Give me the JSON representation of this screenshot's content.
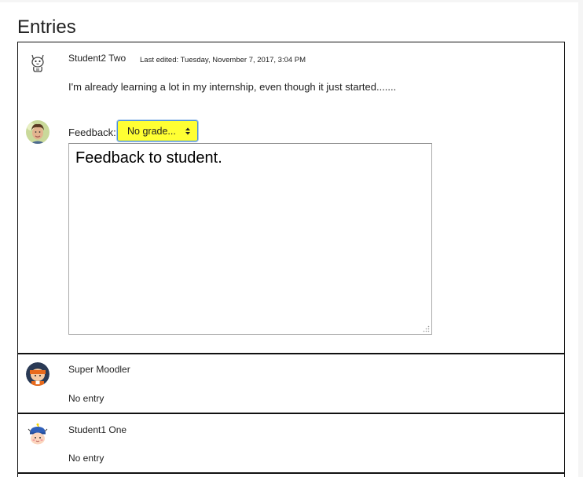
{
  "heading": "Entries",
  "entries": [
    {
      "author": "Student2 Two",
      "last_edited": "Last edited: Tuesday, November 7, 2017, 3:04 PM",
      "text": "I'm already learning a lot in my internship, even though it just started.......",
      "feedback_label": "Feedback:",
      "grade_selected": "No grade...",
      "feedback_text": "Feedback to student."
    },
    {
      "author": "Super Moodler",
      "status": "No entry"
    },
    {
      "author": "Student1 One",
      "status": "No entry"
    }
  ],
  "icons": {
    "author_avatar_1": "cat-avatar-icon",
    "teacher_avatar": "teacher-avatar-icon",
    "author_avatar_2": "moodler-avatar-icon",
    "author_avatar_3": "student-avatar-icon",
    "select_arrow": "sort-arrows-icon",
    "textarea_resize": "resize-grip-icon"
  },
  "colors": {
    "grade_select_bg": "#ffff33",
    "grade_select_border": "#4a90d9"
  }
}
